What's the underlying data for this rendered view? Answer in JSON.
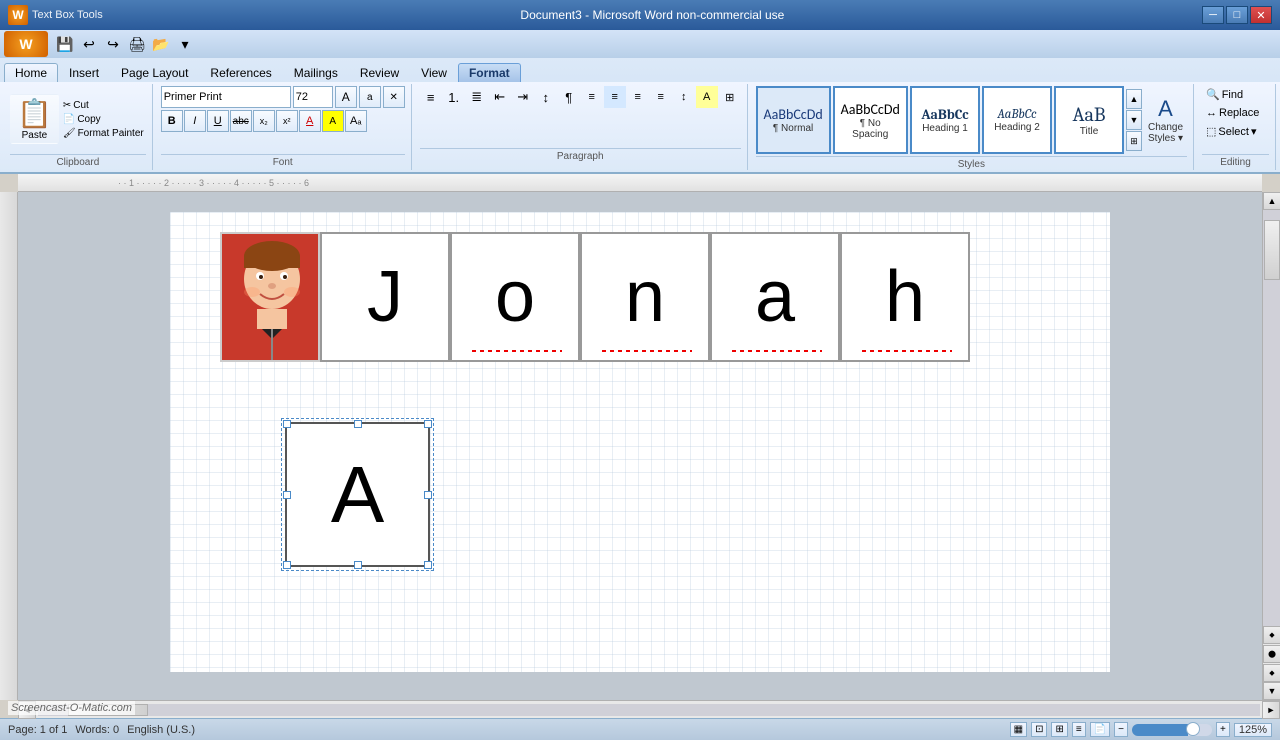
{
  "window": {
    "title": "Document3 - Microsoft Word non-commercial use",
    "textbox_tools": "Text Box Tools",
    "minimize": "─",
    "maximize": "□",
    "close": "✕"
  },
  "qat": {
    "save": "💾",
    "undo": "↩",
    "redo": "↪",
    "print": "🖨",
    "open": "📂"
  },
  "ribbon": {
    "tabs": [
      "Home",
      "Insert",
      "Page Layout",
      "References",
      "Mailings",
      "Review",
      "View",
      "Format"
    ],
    "active_tab": "Home",
    "format_tab": "Format"
  },
  "clipboard": {
    "paste_label": "Paste",
    "cut": "Cut",
    "copy": "Copy",
    "format_painter": "Format Painter",
    "group_label": "Clipboard"
  },
  "font": {
    "name": "Primer Print",
    "size": "72",
    "grow": "A",
    "shrink": "a",
    "clear": "✕",
    "bold": "B",
    "italic": "I",
    "underline": "U",
    "strikethrough": "abc",
    "subscript": "x₂",
    "superscript": "x²",
    "color_label": "A",
    "highlight": "🖊",
    "group_label": "Font"
  },
  "paragraph": {
    "bullets": "≡",
    "numbering": "1.",
    "multilevel": "≣",
    "group_label": "Paragraph"
  },
  "styles": {
    "items": [
      {
        "id": "normal",
        "preview_top": "AaBbCcDd",
        "preview_bottom": "¶ Normal",
        "active": true
      },
      {
        "id": "no-spacing",
        "preview_top": "AaBbCcDd",
        "preview_bottom": "¶ No Spacing",
        "active": false
      },
      {
        "id": "heading1",
        "preview_top": "AaBbCc",
        "preview_bottom": "Heading 1",
        "active": false
      },
      {
        "id": "heading2",
        "preview_top": "AaBbCc",
        "preview_bottom": "Heading 2",
        "active": false
      },
      {
        "id": "title",
        "preview_top": "AaB",
        "preview_bottom": "Title",
        "active": false
      }
    ],
    "change_styles_label": "Change\nStyles",
    "change_styles_icon": "▼",
    "group_label": "Styles"
  },
  "editing": {
    "find_label": "Find",
    "replace_label": "Replace",
    "select_label": "Select",
    "group_label": "Editing"
  },
  "document": {
    "letters": [
      "J",
      "o",
      "n",
      "a",
      "h"
    ],
    "selected_letter": "A",
    "zoom": "125%"
  },
  "status": {
    "page_info": "Page: 1 of 1",
    "words": "Words: 0",
    "language": "English (U.S.)",
    "zoom_level": "125%"
  },
  "watermark": "Screencast-O-Matic.com"
}
